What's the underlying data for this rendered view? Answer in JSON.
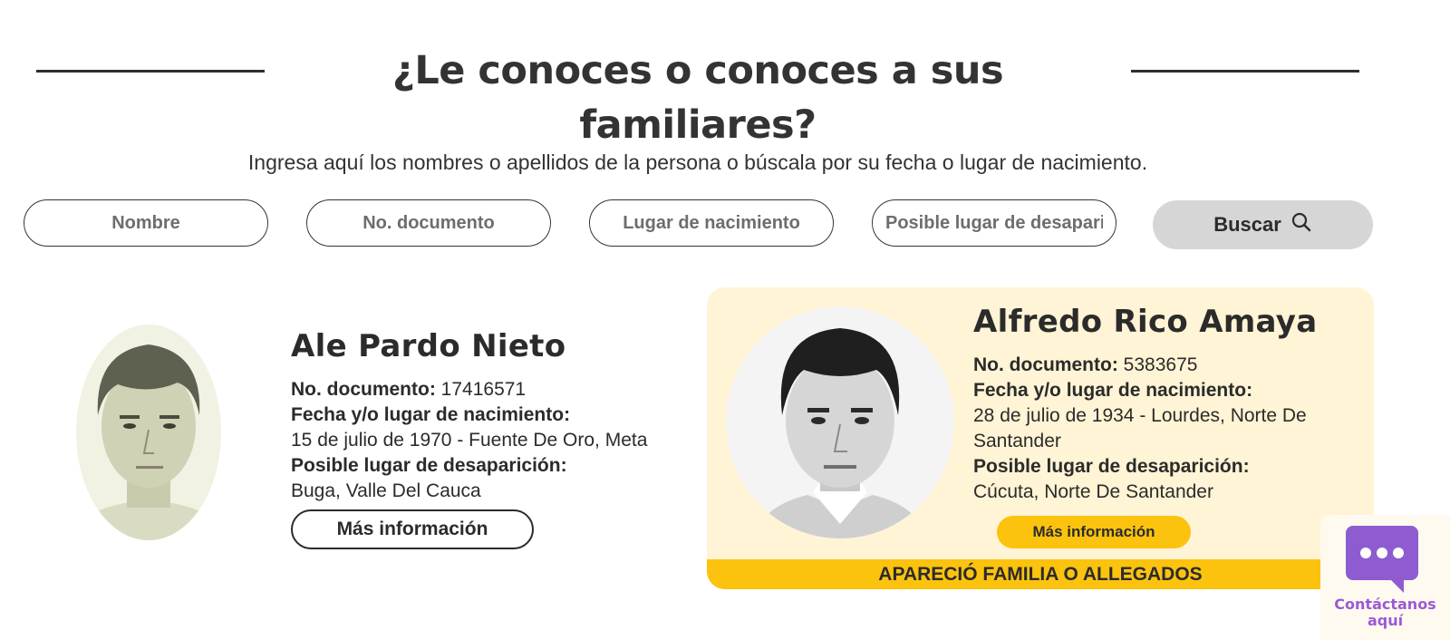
{
  "header": {
    "title": "¿Le conoces o conoces a sus familiares?",
    "subtitle": "Ingresa aquí los nombres o apellidos de la persona o búscala por su fecha o lugar de nacimiento."
  },
  "search": {
    "name_placeholder": "Nombre",
    "document_placeholder": "No. documento",
    "birthplace_placeholder": "Lugar de nacimiento",
    "disappearance_placeholder": "Posible lugar de desaparición",
    "button_label": "Buscar",
    "button_icon": "search-icon"
  },
  "persons": [
    {
      "name": "Ale Pardo Nieto",
      "document_label": "No. documento:",
      "document": "17416571",
      "birth_label": "Fecha y/o lugar de nacimiento:",
      "birth": "15 de julio de 1970 - Fuente De Oro, Meta",
      "disappearance_label": "Posible lugar de desaparición:",
      "disappearance": "Buga, Valle Del Cauca",
      "more_label": "Más información"
    },
    {
      "name": "Alfredo Rico Amaya",
      "document_label": "No. documento:",
      "document": "5383675",
      "birth_label": "Fecha y/o lugar de nacimiento:",
      "birth": "28 de julio de 1934 - Lourdes, Norte De Santander",
      "disappearance_label": "Posible lugar de desaparición:",
      "disappearance": "Cúcuta, Norte De Santander",
      "more_label": "Más información",
      "banner": "APARECIÓ FAMILIA O ALLEGADOS"
    }
  ],
  "chat": {
    "label_line1": "Contáctanos",
    "label_line2": "aquí",
    "icon": "chat-bubble-icon"
  },
  "colors": {
    "accent_yellow": "#fcc30e",
    "card_highlight": "#fff4d5",
    "chat_purple": "#8e5cd0",
    "search_button": "#d6d6d6"
  }
}
